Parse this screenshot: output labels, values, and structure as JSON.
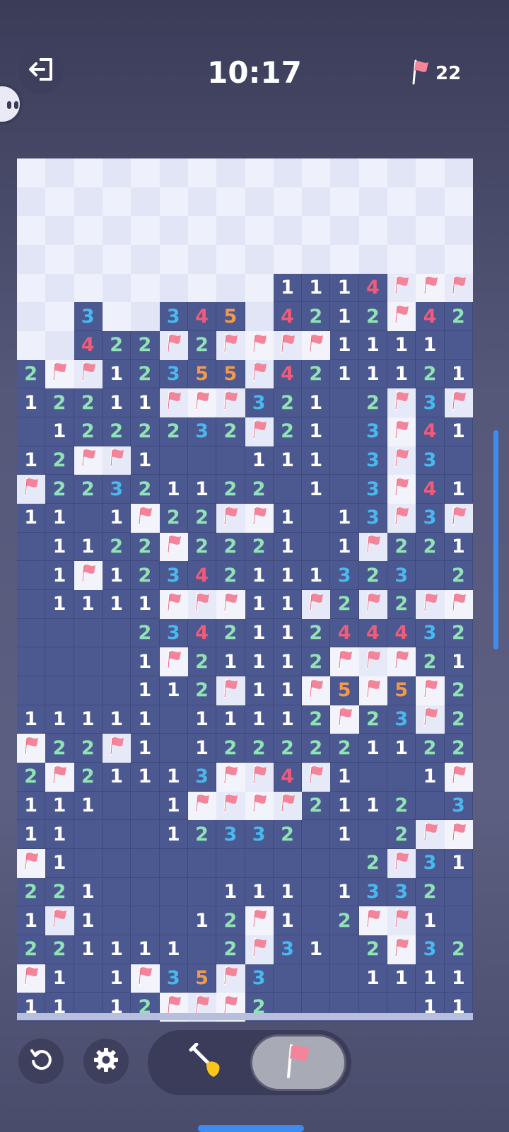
{
  "header": {
    "timer": "10:17",
    "flags_remaining": "22",
    "exit_icon": "exit-icon",
    "flag_icon": "flag-icon"
  },
  "colors": {
    "n1": "#ffffff",
    "n2": "#8fe3b4",
    "n3": "#49b8ef",
    "n4": "#ee5b7c",
    "n5": "#f29a4a",
    "revealed": "#4c5890",
    "hidden": "#eef0fb",
    "flag": "#f3849a"
  },
  "board": {
    "cols": 16,
    "rows": 30,
    "legend": "# = hidden, F = flag, . = revealed empty, digit = number",
    "grid": [
      "################",
      "################",
      "################",
      "################",
      "#########1114FFF",
      "##3##345#4212F42",
      "##422F2FFFF1111.",
      "2FF12355F4211121",
      "12211FFF321.2F3F",
      ".1222232F21.3F41",
      "12FF1...111.3F3.",
      "F22321122.1.3F41",
      "11.1F22FF1.13F3F",
      ".1122F2221.1F221",
      ".1F12342111323.2",
      ".1111FFF11F2F2FF",
      "....234211244432",
      "....1F21112FFF21",
      "....112F11F5F5F2",
      "11111.11112F23F2",
      "F22F1.1222221122",
      "2F21113FF4F1..1F",
      "111..1FFFF2112.32",
      "11...12332.1.2FF1",
      "F1..........2F31",
      "221....111.1332.",
      "1F1...12F1.2FF1.",
      "221111.2F31.2F321",
      "F1.1F35F3...1111F",
      "11.12FFF2.....11"
    ]
  },
  "controls": {
    "undo_icon": "undo-icon",
    "settings_icon": "gear-icon",
    "dig_mode_icon": "shovel-icon",
    "flag_mode_icon": "flag-icon",
    "active_mode": "flag"
  }
}
